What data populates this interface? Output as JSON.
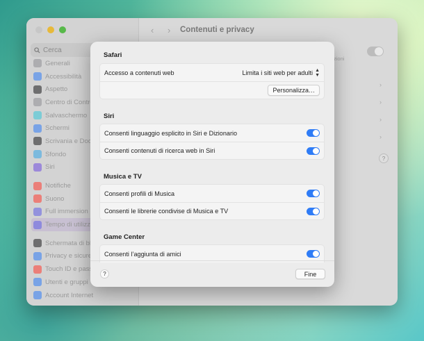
{
  "window": {
    "title": "Contenuti e privacy",
    "search_placeholder": "Cerca",
    "nav": "‹ ›"
  },
  "sidebar": {
    "items": [
      {
        "label": "Generali",
        "color": "#8e8e93"
      },
      {
        "label": "Accessibilità",
        "color": "#2f7cf6"
      },
      {
        "label": "Aspetto",
        "color": "#1c1c1e"
      },
      {
        "label": "Centro di Controllo",
        "color": "#8e8e93"
      },
      {
        "label": "Salvaschermo",
        "color": "#35c7d9"
      },
      {
        "label": "Schermi",
        "color": "#2f7cf6"
      },
      {
        "label": "Scrivania e Dock",
        "color": "#1c1c1e"
      },
      {
        "label": "Sfondo",
        "color": "#35a6e8"
      },
      {
        "label": "Siri",
        "color": "#6f4de0"
      },
      {
        "label": "Notifiche",
        "color": "#ff3b30"
      },
      {
        "label": "Suono",
        "color": "#ff3b30"
      },
      {
        "label": "Full immersion",
        "color": "#5e5ce6"
      },
      {
        "label": "Tempo di utilizzo",
        "color": "#5e5ce6"
      },
      {
        "label": "Schermata di blocco",
        "color": "#1c1c1e"
      },
      {
        "label": "Privacy e sicurezza",
        "color": "#2f7cf6"
      },
      {
        "label": "Touch ID e password",
        "color": "#ff3b30"
      },
      {
        "label": "Utenti e gruppi",
        "color": "#2f7cf6"
      },
      {
        "label": "Account Internet",
        "color": "#2f7cf6"
      }
    ]
  },
  "background": {
    "partial_text": "zioni",
    "help": "?"
  },
  "modal": {
    "sections": [
      {
        "title": "Safari",
        "rows": [
          {
            "label": "Accesso a contenuti web",
            "control": "popup",
            "value": "Limita i siti web per adulti"
          },
          {
            "control": "button",
            "button_label": "Personalizza…"
          }
        ]
      },
      {
        "title": "Siri",
        "rows": [
          {
            "label": "Consenti linguaggio esplicito in Siri e Dizionario",
            "control": "toggle",
            "on": true
          },
          {
            "label": "Consenti contenuti di ricerca web in Siri",
            "control": "toggle",
            "on": true
          }
        ]
      },
      {
        "title": "Musica e TV",
        "rows": [
          {
            "label": "Consenti profili di Musica",
            "control": "toggle",
            "on": true
          },
          {
            "label": "Consenti le librerie condivise di Musica e TV",
            "control": "toggle",
            "on": true
          }
        ]
      },
      {
        "title": "Game Center",
        "rows": [
          {
            "label": "Consenti l’aggiunta di amici",
            "control": "toggle",
            "on": true
          }
        ]
      }
    ],
    "footer": {
      "help_label": "?",
      "done_label": "Fine"
    }
  },
  "colors": {
    "accent": "#2f7cf6"
  }
}
